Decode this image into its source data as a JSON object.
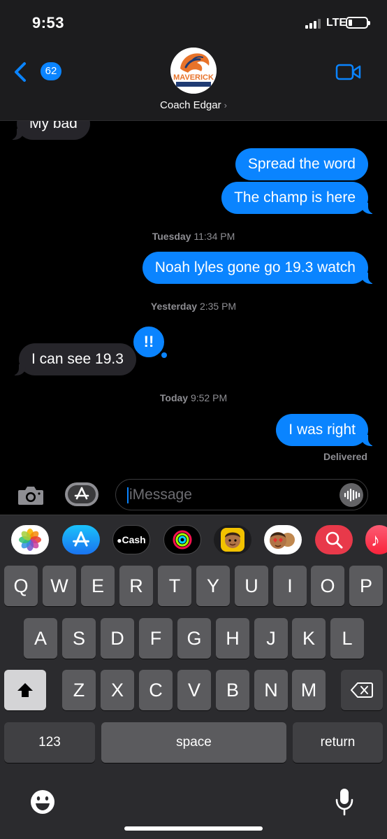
{
  "status_bar": {
    "time": "9:53",
    "network": "LTE"
  },
  "nav": {
    "back_count": "62",
    "contact_name": "Coach Edgar",
    "avatar_text": "MAVERICK"
  },
  "messages": [
    {
      "direction": "in",
      "text": "My bad"
    },
    {
      "direction": "out",
      "text": "Spread the word"
    },
    {
      "direction": "out",
      "text": "The champ is here"
    },
    {
      "type": "timestamp",
      "day": "Tuesday",
      "time": "11:34 PM"
    },
    {
      "direction": "out",
      "text": "Noah lyles gone go 19.3 watch"
    },
    {
      "type": "timestamp",
      "day": "Yesterday",
      "time": "2:35 PM"
    },
    {
      "direction": "in",
      "text": "I can see 19.3",
      "tapback": "!!"
    },
    {
      "type": "timestamp",
      "day": "Today",
      "time": "9:52 PM"
    },
    {
      "direction": "out",
      "text": "I was right"
    }
  ],
  "delivery_status": "Delivered",
  "input": {
    "placeholder": "iMessage"
  },
  "app_strip": [
    {
      "name": "Photos",
      "icon": "photos-icon"
    },
    {
      "name": "App Store",
      "icon": "app-store-icon"
    },
    {
      "name": "Apple Cash",
      "icon": "apple-cash-icon",
      "label": "Cash"
    },
    {
      "name": "Activity",
      "icon": "activity-rings-icon"
    },
    {
      "name": "Memoji",
      "icon": "memoji-icon"
    },
    {
      "name": "Memoji Stickers",
      "icon": "memoji-stickers-icon"
    },
    {
      "name": "Search",
      "icon": "web-search-icon"
    },
    {
      "name": "Music",
      "icon": "music-icon"
    }
  ],
  "keyboard": {
    "row1": [
      "Q",
      "W",
      "E",
      "R",
      "T",
      "Y",
      "U",
      "I",
      "O",
      "P"
    ],
    "row2": [
      "A",
      "S",
      "D",
      "F",
      "G",
      "H",
      "J",
      "K",
      "L"
    ],
    "row3": [
      "Z",
      "X",
      "C",
      "V",
      "B",
      "N",
      "M"
    ],
    "numbers_label": "123",
    "space_label": "space",
    "return_label": "return"
  },
  "colors": {
    "accent": "#0a84ff",
    "incoming_bubble": "#26252a",
    "keyboard_bg": "#2b2b2e",
    "key": "#5b5b5e"
  }
}
